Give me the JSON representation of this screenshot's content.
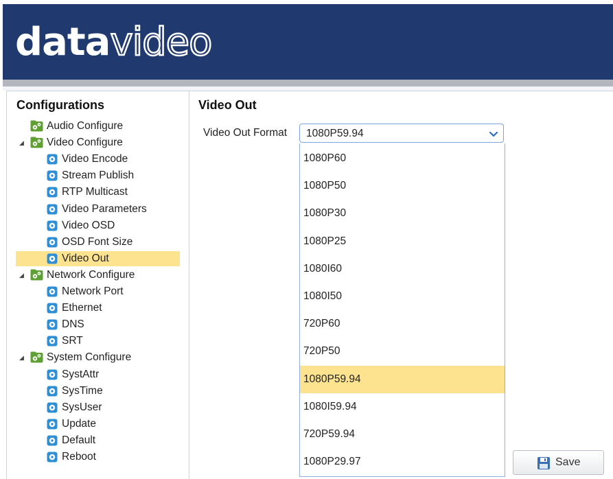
{
  "brand": {
    "logo_bold": "data",
    "logo_outline": "video"
  },
  "sidebar": {
    "title": "Configurations",
    "groups": [
      {
        "label": "Audio Configure",
        "icon": "gears-folder-icon",
        "expanded": null,
        "items": []
      },
      {
        "label": "Video Configure",
        "icon": "gears-folder-icon",
        "expanded": true,
        "items": [
          "Video Encode",
          "Stream Publish",
          "RTP Multicast",
          "Video Parameters",
          "Video OSD",
          "OSD Font Size",
          "Video Out"
        ]
      },
      {
        "label": "Network Configure",
        "icon": "gears-folder-icon",
        "expanded": true,
        "items": [
          "Network Port",
          "Ethernet",
          "DNS",
          "SRT"
        ]
      },
      {
        "label": "System Configure",
        "icon": "gears-folder-icon",
        "expanded": true,
        "items": [
          "SystAttr",
          "SysTime",
          "SysUser",
          "Update",
          "Default",
          "Reboot"
        ]
      }
    ],
    "selected_item": "Video Out"
  },
  "main": {
    "title": "Video Out",
    "video_out_format": {
      "label": "Video Out Format",
      "value": "1080P59.94",
      "options": [
        "1080P60",
        "1080P50",
        "1080P30",
        "1080P25",
        "1080I60",
        "1080I50",
        "720P60",
        "720P50",
        "1080P59.94",
        "1080I59.94",
        "720P59.94",
        "1080P29.97"
      ],
      "highlighted": "1080P59.94"
    },
    "save_label": "Save"
  },
  "colors": {
    "header": "#203a70",
    "highlight": "#fde38f",
    "select_border": "#7aa4de"
  }
}
